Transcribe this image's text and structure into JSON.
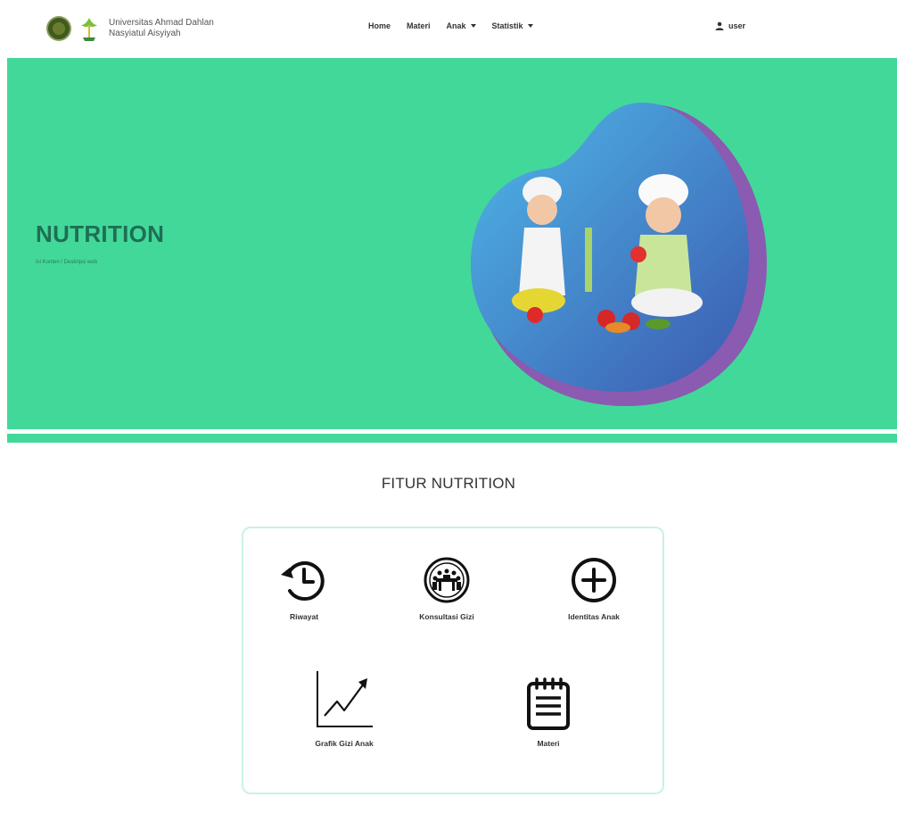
{
  "navbar": {
    "brand_line1": "Universitas Ahmad Dahlan",
    "brand_line2": "Nasyiatul Aisyiyah",
    "menu": [
      {
        "label": "Home"
      },
      {
        "label": "Materi"
      },
      {
        "label": "Anak"
      },
      {
        "label": "Statistik"
      }
    ],
    "user_label": "user"
  },
  "hero": {
    "title": "NUTRITION",
    "subtitle": "Isi Konten / Deskripsi web",
    "background_color": "#42d899"
  },
  "section": {
    "title": "FITUR NUTRITION"
  },
  "features": [
    {
      "label": "Riwayat",
      "icon": "history-icon"
    },
    {
      "label": "Konsultasi Gizi",
      "icon": "meeting-icon"
    },
    {
      "label": "Identitas Anak",
      "icon": "plus-circle-icon"
    },
    {
      "label": "Grafik Gizi Anak",
      "icon": "chart-icon"
    },
    {
      "label": "Materi",
      "icon": "notepad-icon"
    }
  ]
}
